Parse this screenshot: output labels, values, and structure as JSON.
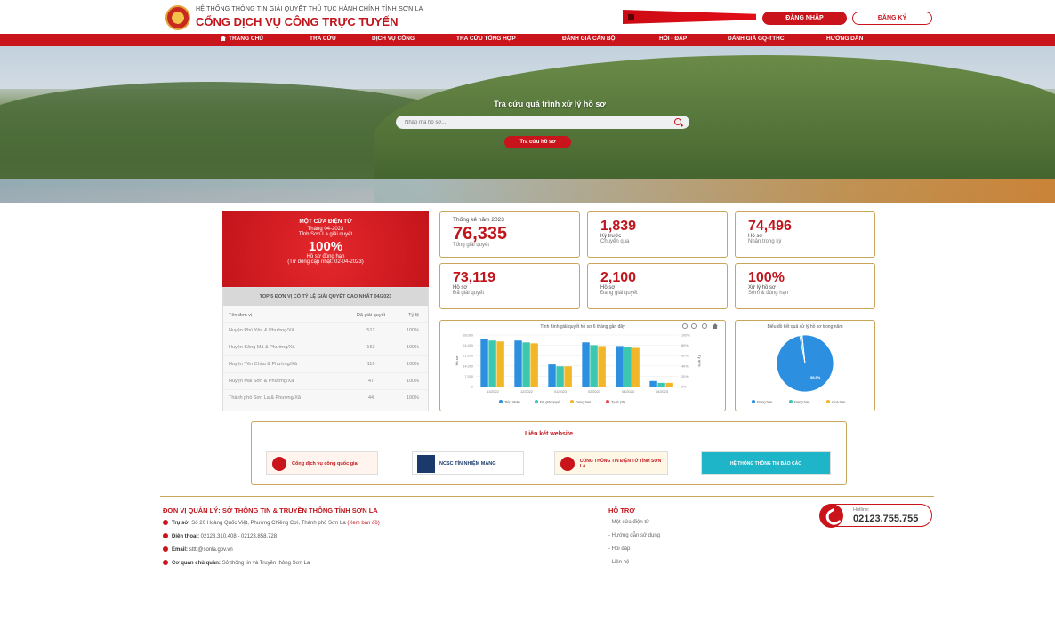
{
  "header": {
    "subtitle": "HỆ THỐNG THÔNG TIN GIẢI QUYẾT THỦ TỤC HÀNH CHÍNH TỈNH SƠN LA",
    "title": "CỔNG DỊCH VỤ CÔNG TRỰC TUYẾN",
    "login_label": "ĐĂNG NHẬP",
    "register_label": "ĐĂNG KÝ"
  },
  "nav": {
    "items": [
      "TRANG CHỦ",
      "TRA CỨU",
      "DỊCH VỤ CÔNG",
      "TRA CỨU TỔNG HỢP",
      "ĐÁNH GIÁ CÁN BỘ",
      "HỎI - ĐÁP",
      "ĐÁNH GIÁ GQ-TTHC",
      "HƯỚNG DẪN"
    ]
  },
  "hero": {
    "title": "Tra cứu quá trình xử lý hồ sơ",
    "search_placeholder": "Nhập mã hồ sơ...",
    "search_button": "Tra cứu hồ sơ"
  },
  "one_gate": {
    "title": "MỘT CỬA ĐIỆN TỬ",
    "month": "Tháng 04-2023",
    "line": "Tỉnh Sơn La giải quyết",
    "percent": "100%",
    "caption": "Hồ sơ đúng hạn",
    "updated": "(Tự động cập nhật: 02-04-2023)"
  },
  "top5": {
    "heading": "TOP 5 ĐƠN VỊ CÓ TỶ LỆ GIẢI QUYẾT CAO NHẤT 04/2023",
    "columns": [
      "Tên đơn vị",
      "Đã giải quyết",
      "Tỷ lệ"
    ],
    "rows": [
      [
        "Huyện Phù Yên & Phường/Xã",
        "512",
        "100%"
      ],
      [
        "Huyện Sông Mã & Phường/Xã",
        "163",
        "100%"
      ],
      [
        "Huyện Yên Châu & Phường/Xã",
        "116",
        "100%"
      ],
      [
        "Huyện Mai Sơn & Phường/Xã",
        "47",
        "100%"
      ],
      [
        "Thành phố Sơn La & Phường/Xã",
        "44",
        "100%"
      ]
    ]
  },
  "stats": {
    "year_header": "Thống kê năm 2023",
    "total": {
      "value": "76,335",
      "label": "Tổng giải quyết"
    },
    "prior": {
      "value": "1,839",
      "label": "Kỳ trước",
      "sub": "Chuyển qua"
    },
    "received": {
      "value": "74,496",
      "label": "Hồ sơ",
      "sub": "Nhận trong kỳ"
    },
    "resolved": {
      "value": "73,119",
      "label": "Hồ sơ",
      "sub": "Đã giải quyết"
    },
    "processing": {
      "value": "2,100",
      "label": "Hồ sơ",
      "sub": "Đang giải quyết"
    },
    "ontime": {
      "value": "100%",
      "label": "Xử lý hồ sơ",
      "sub": "Sớm & đúng hạn"
    }
  },
  "bar_chart": {
    "title": "Tình hình giải quyết hồ sơ 6 tháng gần đây",
    "ylabel": "Hồ sơ",
    "y2label": "Tỷ lệ %",
    "ticks_left": [
      "28,000",
      "24,000",
      "21,000",
      "14,000",
      "7,000",
      "0"
    ],
    "ticks_right": [
      "100%",
      "80%",
      "60%",
      "40%",
      "20%",
      "0%"
    ],
    "legend": [
      "Tiếp nhận",
      "Đã giải quyết",
      "Đúng hạn",
      "Tỷ lệ (%)"
    ]
  },
  "pie_chart": {
    "title": "Biểu đồ kết quả xử lý hồ sơ trong năm",
    "center_label": "98.6%",
    "legend": [
      "Đúng hạn",
      "Đang hạn",
      "Quá hạn"
    ]
  },
  "chart_data": [
    {
      "type": "bar",
      "categories": [
        "11/2022",
        "12/2022",
        "01/2023",
        "02/2023",
        "03/2023",
        "04/2023"
      ],
      "series": [
        {
          "name": "Tiếp nhận",
          "values": [
            26000,
            25000,
            12000,
            24000,
            22000,
            3000
          ]
        },
        {
          "name": "Đã giải quyết",
          "values": [
            25000,
            24000,
            11000,
            22500,
            21500,
            2000
          ]
        },
        {
          "name": "Đúng hạn",
          "values": [
            24500,
            23500,
            11000,
            22000,
            21000,
            2000
          ]
        }
      ],
      "ylim": [
        0,
        28000
      ],
      "colors": [
        "#2d8fe0",
        "#3cc7b0",
        "#f2b728"
      ]
    },
    {
      "type": "pie",
      "categories": [
        "Đúng hạn",
        "Đang hạn",
        "Quá hạn"
      ],
      "values": [
        98.6,
        1.2,
        0.2
      ],
      "colors": [
        "#2d8fe0",
        "#3cc7b0",
        "#f2b728"
      ]
    }
  ],
  "links": {
    "title": "Liên kết website",
    "items": [
      {
        "label": "Cổng dịch vụ công quốc gia"
      },
      {
        "label": "NCSC TÍN NHIỆM MẠNG"
      },
      {
        "label": "CỔNG THÔNG TIN ĐIỆN TỬ TỈNH SƠN LA"
      },
      {
        "label": "HỆ THỐNG THÔNG TIN BÁO CÁO"
      }
    ]
  },
  "footer": {
    "title": "ĐƠN VỊ QUẢN LÝ: SỞ THÔNG TIN & TRUYỀN THÔNG TỈNH SƠN LA",
    "address_label": "Trụ sở:",
    "address": "Số 20 Hoàng Quốc Việt, Phường Chiềng Cơi, Thành phố Sơn La",
    "map_link": "(Xem bản đồ)",
    "phone_label": "Điện thoại:",
    "phone": "02123.310.408 - 02123.858.728",
    "email_label": "Email:",
    "email": "stttt@sonla.gov.vn",
    "owner_label": "Cơ quan chủ quản:",
    "owner": "Sở thông tin và Truyền thông Sơn La",
    "help_title": "HỖ TRỢ",
    "help_items": [
      "Một cửa điện tử",
      "Hướng dẫn sử dụng",
      "Hỏi đáp",
      "Liên hệ"
    ],
    "hotline_label": "Hotline:",
    "hotline": "02123.755.755"
  }
}
